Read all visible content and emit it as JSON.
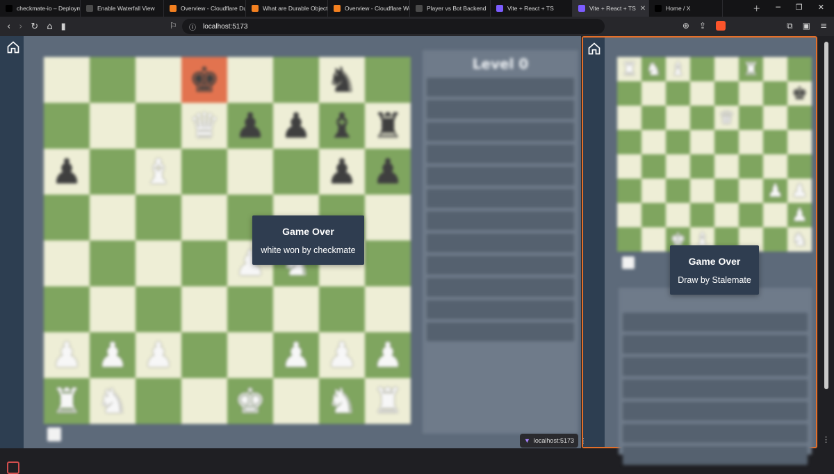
{
  "tabs": [
    {
      "title": "checkmate-io – Deployme",
      "favicon": "vercel-icon",
      "color": "#000000"
    },
    {
      "title": "Enable Waterfall View",
      "favicon": "globe-icon",
      "color": "#4a4a4a"
    },
    {
      "title": "Overview - Cloudflare Dura",
      "favicon": "cloudflare-icon",
      "color": "#f38020"
    },
    {
      "title": "What are Durable Objects?",
      "favicon": "cloudflare-doc-icon",
      "color": "#f38020"
    },
    {
      "title": "Overview - Cloudflare Wor",
      "favicon": "cloudflare-icon",
      "color": "#f38020"
    },
    {
      "title": "Player vs Bot Backend",
      "favicon": "globe-icon",
      "color": "#4a4a4a"
    },
    {
      "title": "Vite + React + TS",
      "favicon": "vite-icon",
      "color": "#7c5cff"
    },
    {
      "title": "Vite + React + TS",
      "favicon": "vite-icon",
      "color": "#7c5cff"
    },
    {
      "title": "Home / X",
      "favicon": "x-icon",
      "color": "#000000"
    }
  ],
  "address": {
    "url": "localhost:5173"
  },
  "left_game": {
    "level_title": "Level 0",
    "modal_title": "Game Over",
    "modal_subtitle": "white won by checkmate",
    "board": [
      [
        "",
        "",
        "",
        "k",
        "",
        "",
        "n",
        ""
      ],
      [
        "",
        "",
        "",
        "Q",
        "p",
        "p",
        "b",
        "r"
      ],
      [
        "p",
        "",
        "B",
        "",
        "",
        "",
        "p",
        "p"
      ],
      [
        "",
        "",
        "",
        "",
        "",
        "",
        "",
        ""
      ],
      [
        "",
        "",
        "",
        "",
        "P",
        "N",
        "",
        ""
      ],
      [
        "",
        "",
        "",
        "",
        "",
        "",
        "",
        ""
      ],
      [
        "P",
        "P",
        "P",
        "",
        "",
        "P",
        "P",
        "P"
      ],
      [
        "R",
        "N",
        "",
        "",
        "K",
        "",
        "N",
        "R"
      ]
    ]
  },
  "right_game": {
    "modal_title": "Game Over",
    "modal_subtitle": "Draw by Stalemate",
    "board": [
      [
        "R",
        "N",
        "B",
        "",
        "",
        "R",
        "",
        ""
      ],
      [
        "",
        "",
        "",
        "",
        "",
        "",
        "",
        "k"
      ],
      [
        "",
        "",
        "",
        "",
        "Q",
        "",
        "",
        ""
      ],
      [
        "",
        "",
        "",
        "",
        "",
        "",
        "",
        ""
      ],
      [
        "",
        "",
        "",
        "",
        "",
        "",
        "",
        ""
      ],
      [
        "",
        "",
        "",
        "",
        "",
        "",
        "P",
        "P"
      ],
      [
        "",
        "",
        "",
        "",
        "",
        "",
        "",
        "P"
      ],
      [
        "",
        "",
        "K",
        "B",
        "",
        "",
        "",
        "N"
      ]
    ]
  },
  "status_chip": "localhost:5173",
  "colors": {
    "board_light": "#eeeed6",
    "board_dark": "#7fa55f",
    "panel": "#5d6a7a",
    "sidebar": "#2d3e51",
    "modal": "#2f3d50",
    "focus_border": "#e36f2a"
  }
}
